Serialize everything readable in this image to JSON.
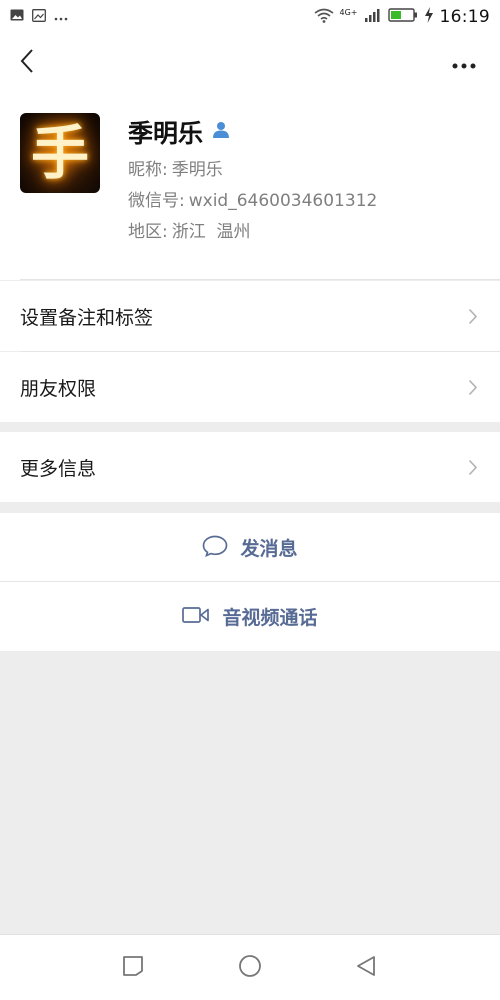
{
  "status_bar": {
    "time": "16:19",
    "network": "4G+",
    "left_icons": [
      "image-icon",
      "gallery-icon",
      "more-dots-icon"
    ],
    "battery_color": "#3bba2c"
  },
  "header": {
    "back_icon": "back-arrow-icon",
    "more_icon": "more-horizontal-icon"
  },
  "profile": {
    "name": "季明乐",
    "avatar_glyph": "手",
    "nickname_label": "昵称:",
    "nickname": "季明乐",
    "wechat_id_label": "微信号:",
    "wechat_id": "wxid_6460034601312",
    "region_label": "地区:",
    "region": "浙江  温州",
    "badge_icon": "person-badge-icon"
  },
  "menu": {
    "remark_tags": "设置备注和标签",
    "permissions": "朋友权限",
    "more_info": "更多信息"
  },
  "actions": {
    "send_message": "发消息",
    "video_call": "音视频通话"
  },
  "colors": {
    "accent": "#576b95",
    "background": "#ededed",
    "surface": "#ffffff"
  },
  "nav": {
    "buttons": [
      "recent-apps-icon",
      "home-icon",
      "back-triangle-icon"
    ]
  }
}
